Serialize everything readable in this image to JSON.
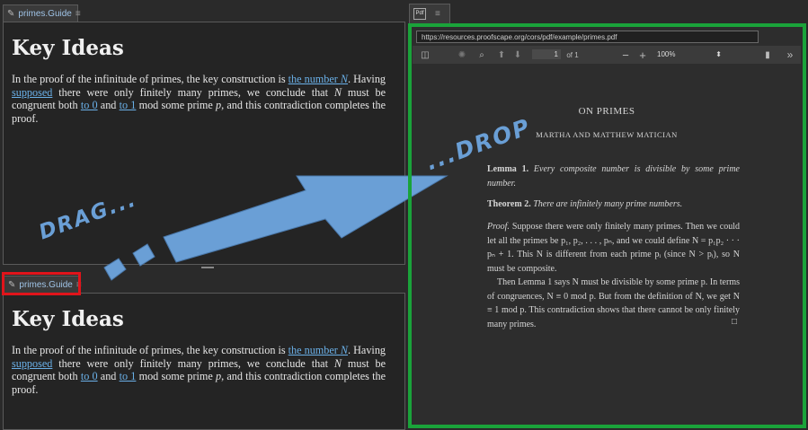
{
  "top_guide": {
    "tab_label": "primes.Guide",
    "heading": "Key Ideas",
    "p1": "In the proof of the infinitude of primes, the key construction is ",
    "link_number": "the number ",
    "link_number_var": "N",
    "p2": ". Having ",
    "link_supposed": "supposed",
    "p3": " there were only finitely many primes, we conclude that ",
    "var_n": "N",
    "p4": " must be congruent both ",
    "link_to0": "to 0",
    "p5": " and ",
    "link_to1": "to 1",
    "p6": " mod some prime ",
    "var_p": "p",
    "p7": ", and this contradiction completes the proof."
  },
  "bottom_guide": {
    "tab_label": "primes.Guide",
    "heading": "Key Ideas",
    "p1": "In the proof of the infinitude of primes, the key construction is ",
    "link_number": "the number ",
    "link_number_var": "N",
    "p2": ". Having ",
    "link_supposed": "supposed",
    "p3": " there were only finitely many primes, we conclude that ",
    "var_n": "N",
    "p4": " must be congruent both ",
    "link_to0": "to 0",
    "p5": " and ",
    "link_to1": "to 1",
    "p6": " mod some prime ",
    "var_p": "p",
    "p7": ", and this contradiction completes the proof."
  },
  "pdf_pane": {
    "tab_label": "Pdf",
    "url": "https://resources.proofscape.org/cors/pdf/example/primes.pdf",
    "page_number": "1",
    "page_of": "of 1",
    "zoom": "100%",
    "title": "ON PRIMES",
    "authors": "MARTHA AND MATTHEW MATICIAN",
    "lemma_label": "Lemma 1.",
    "lemma_text": "Every composite number is divisible by some prime number.",
    "theorem_label": "Theorem 2.",
    "theorem_text": "There are infinitely many prime numbers.",
    "proof_label": "Proof.",
    "proof_p1": "Suppose there were only finitely many primes. Then we could let all the primes be p₁, p₂, . . . , pₙ, and we could define N = p₁p₂ · · · pₙ + 1. This N is different from each prime pᵢ (since N > pᵢ), so N must be composite.",
    "proof_p2": "Then Lemma 1 says N must be divisible by some prime p. In terms of congruences, N ≡ 0 mod p. But from the definition of N, we get N ≡ 1 mod p. This contradiction shows that there cannot be only finitely many primes.",
    "qed": "□"
  },
  "annotations": {
    "drag": "DRAG...",
    "drop": "...DROP"
  },
  "colors": {
    "drop_frame": "#1aa33a",
    "drag_frame": "#e0141b",
    "arrow": "#6a9fd6",
    "link": "#6ab0e8"
  }
}
